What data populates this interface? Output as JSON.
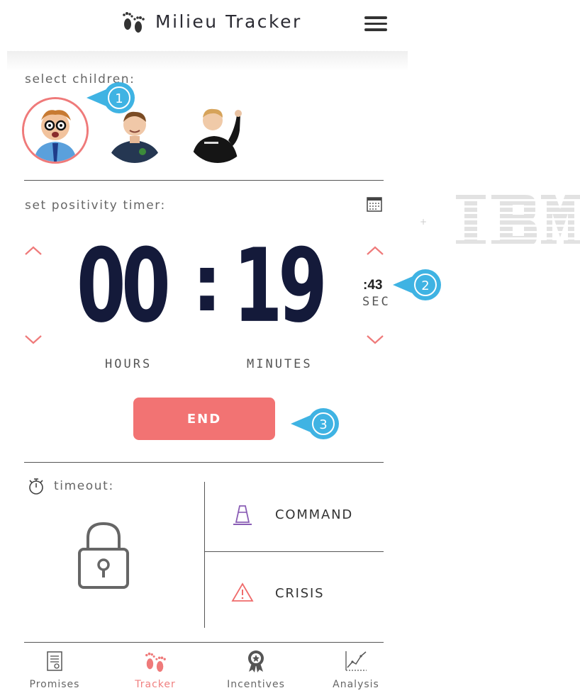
{
  "header": {
    "title": "Milieu Tracker",
    "logo_icon": "footprints-icon",
    "menu_icon": "hamburger-menu-icon"
  },
  "children_section": {
    "label": "select children:",
    "children": [
      {
        "avatar": "child-avatar",
        "selected": true
      },
      {
        "avatar": "child-avatar",
        "selected": false
      },
      {
        "avatar": "child-avatar",
        "selected": false
      }
    ]
  },
  "timer": {
    "label": "set positivity timer:",
    "calendar_icon": "calendar-icon",
    "hours": "00",
    "separator": ":",
    "minutes": "19",
    "seconds": ":43",
    "hours_label": "HOURS",
    "minutes_label": "MINUTES",
    "seconds_label": "SEC",
    "end_button": "END"
  },
  "callouts": [
    "1",
    "2",
    "3"
  ],
  "timeout": {
    "label": "timeout:",
    "icon": "stopwatch-icon",
    "lock_icon": "lock-icon",
    "actions": [
      {
        "label": "COMMAND",
        "icon": "traffic-cone-icon"
      },
      {
        "label": "CRISIS",
        "icon": "warning-triangle-icon"
      }
    ]
  },
  "nav": {
    "items": [
      {
        "label": "Promises",
        "icon": "certificate-icon",
        "active": false
      },
      {
        "label": "Tracker",
        "icon": "footprints-icon",
        "active": true
      },
      {
        "label": "Incentives",
        "icon": "award-ribbon-icon",
        "active": false
      },
      {
        "label": "Analysis",
        "icon": "line-chart-icon",
        "active": false
      }
    ]
  },
  "colors": {
    "accent": "#f27373",
    "callout": "#3fb3e3",
    "digits": "#141a3a",
    "cone": "#8a5db5"
  },
  "watermark": "IBM"
}
